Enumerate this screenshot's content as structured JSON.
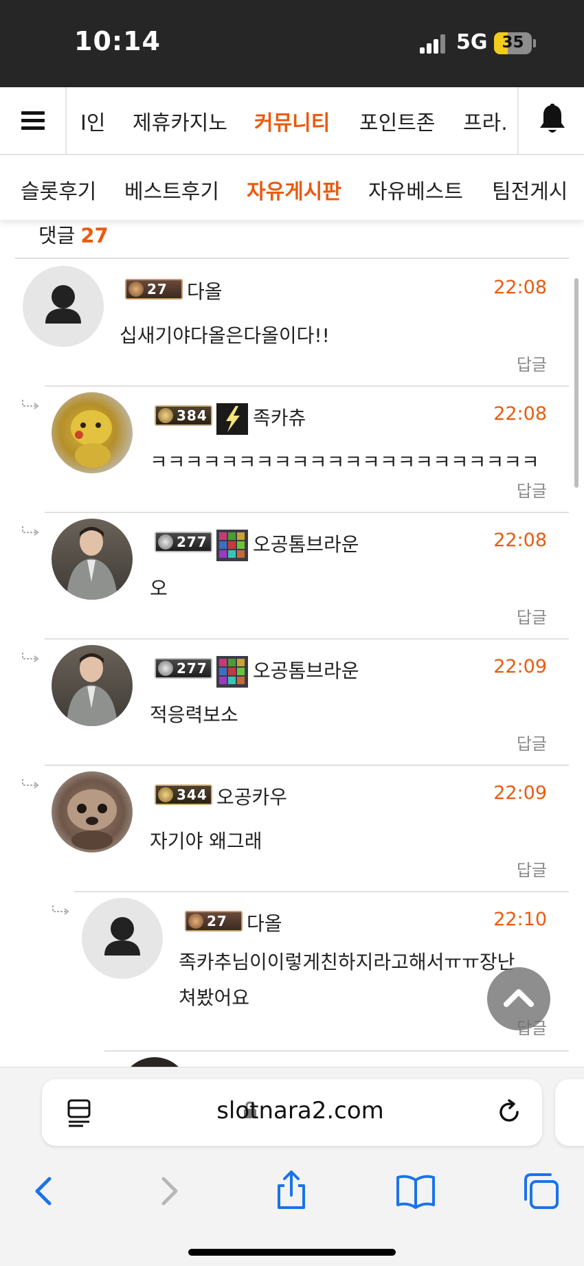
{
  "status_bar": {
    "time": "10:14",
    "network": "5G",
    "battery": "35"
  },
  "top_nav": {
    "items": [
      {
        "label": "I인",
        "active": false
      },
      {
        "label": "제휴카지노",
        "active": false
      },
      {
        "label": "커뮤니티",
        "active": true
      },
      {
        "label": "포인트존",
        "active": false
      },
      {
        "label": "프라.",
        "active": false
      }
    ]
  },
  "sub_nav": {
    "items": [
      {
        "label": "슬롯후기",
        "active": false
      },
      {
        "label": "베스트후기",
        "active": false
      },
      {
        "label": "자유게시판",
        "active": true
      },
      {
        "label": "자유베스트",
        "active": false
      },
      {
        "label": "팀전게시",
        "active": false
      }
    ]
  },
  "comments_section": {
    "title": "댓글",
    "count": "27",
    "reply_label": "답글",
    "comments": [
      {
        "nickname": "다올",
        "level": "27",
        "time": "22:08",
        "text": "십새기야다올은다올이다!!",
        "avatar": "default-avatar"
      },
      {
        "nickname": "족카츄",
        "level": "384",
        "time": "22:08",
        "text": "ㅋㅋㅋㅋㅋㅋㅋㅋㅋㅋㅋㅋㅋㅋㅋㅋㅋㅋㅋㅋㅋㅋ",
        "avatar": "pikachu-avatar"
      },
      {
        "nickname": "오공톰브라운",
        "level": "277",
        "time": "22:08",
        "text": "오",
        "avatar": "person-avatar"
      },
      {
        "nickname": "오공톰브라운",
        "level": "277",
        "time": "22:09",
        "text": "적응력보소",
        "avatar": "person-avatar"
      },
      {
        "nickname": "오공카우",
        "level": "344",
        "time": "22:09",
        "text": "자기야 왜그래",
        "avatar": "pet-avatar"
      },
      {
        "nickname": "다올",
        "level": "27",
        "time": "22:10",
        "text_line1": "족카추님이이렇게친하지라고해서ㅠㅠ장난",
        "text_line2": "쳐봤어요",
        "avatar": "default-avatar"
      }
    ]
  },
  "browser": {
    "url": "slotnara2.com"
  },
  "colors": {
    "accent": "#ea5a0f",
    "status_bar": "#262626",
    "battery": "#f2cc1b"
  }
}
